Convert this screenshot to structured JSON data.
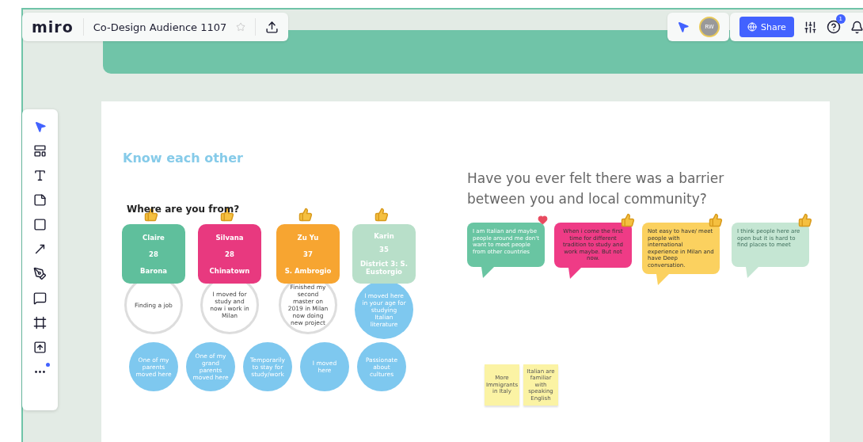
{
  "header": {
    "logo": "miro",
    "board_title": "Co-Design Audience 1107",
    "starred": false
  },
  "collaborators": [
    {
      "initials": "RW"
    }
  ],
  "share_button": "Share",
  "help_badge": "1",
  "board": {
    "section_title": "Know each other",
    "question": "Have you ever felt there was a barrier between you and local community?",
    "subtitle": "Where are you from?",
    "people": [
      {
        "name": "Claire",
        "age": "28",
        "place": "Barona",
        "color": "#5fbf9c",
        "answer": {
          "text": "Finding a job",
          "kind": "outline"
        }
      },
      {
        "name": "Silvana",
        "age": "28",
        "place": "Chinatown",
        "color": "#e8397f",
        "answer": {
          "text": "I moved for study and now i work in Milan",
          "kind": "outline"
        }
      },
      {
        "name": "Zu Yu",
        "age": "37",
        "place": "S. Ambrogio",
        "color": "#f7a531",
        "answer": {
          "text": "Finished my second master on 2019 in Milan now doing new project",
          "kind": "outline"
        }
      },
      {
        "name": "Karin",
        "age": "35",
        "place": "District 3: S. Eustorgio",
        "color": "#b8dfc9",
        "answer": {
          "text": "I moved here in your age for studying Italian literature",
          "kind": "filled"
        }
      }
    ],
    "reasons": [
      "One of my parents moved here",
      "One of my grand parents moved here",
      "Temporarily to stay for study/work",
      "I moved here",
      "Passionate about cultures"
    ],
    "bubbles": [
      {
        "text": "I am Italian and maybe people around me don't want to meet people from other countries",
        "color": "#69c5a2",
        "reaction": {
          "kind": "heart"
        }
      },
      {
        "text": "When i come the first time for different tradition to study and work maybe. But not now.",
        "color": "#ef3b86",
        "reaction": {
          "kind": "thumb"
        }
      },
      {
        "text": "Not easy to have/ meet people with international experience in Milan and have Deep conversation.",
        "color": "#fbd15f",
        "reaction": {
          "kind": "thumb"
        }
      },
      {
        "text": "I think people here are open but it is hard to find places to meet",
        "color": "#c5e6d3",
        "reaction": {
          "kind": "thumb"
        }
      }
    ],
    "stickies": [
      "More Immigrants in Italy",
      "Italian are familiar with speaking English"
    ]
  }
}
